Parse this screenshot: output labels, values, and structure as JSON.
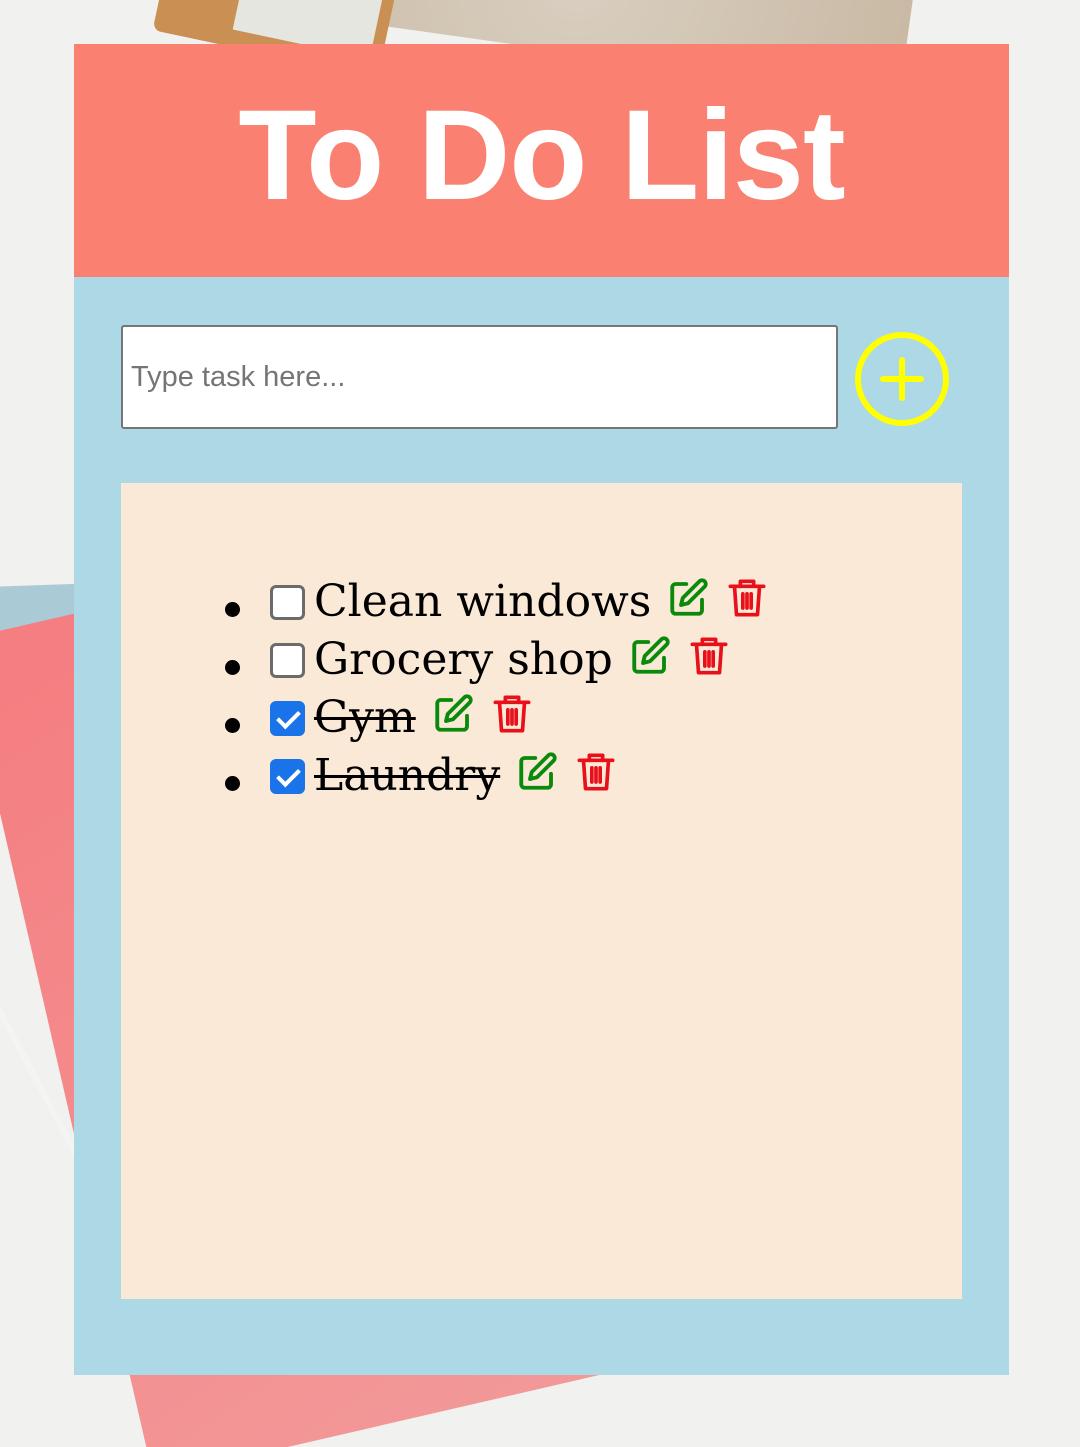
{
  "header": {
    "title": "To Do List"
  },
  "input": {
    "placeholder": "Type task here...",
    "value": ""
  },
  "add_button": {
    "icon": "plus-circle-icon",
    "color": "#ffff00"
  },
  "colors": {
    "header_bg": "#fa8072",
    "app_bg": "#add8e6",
    "list_bg": "#fae9d7",
    "edit_icon": "#0a8a0a",
    "delete_icon": "#e8101a",
    "checkbox_checked": "#1a73e8"
  },
  "tasks": [
    {
      "text": "Clean windows",
      "completed": false,
      "edit_icon": "edit-icon",
      "delete_icon": "trash-icon"
    },
    {
      "text": "Grocery shop",
      "completed": false,
      "edit_icon": "edit-icon",
      "delete_icon": "trash-icon"
    },
    {
      "text": "Gym",
      "completed": true,
      "edit_icon": "edit-icon",
      "delete_icon": "trash-icon"
    },
    {
      "text": "Laundry",
      "completed": true,
      "edit_icon": "edit-icon",
      "delete_icon": "trash-icon"
    }
  ]
}
